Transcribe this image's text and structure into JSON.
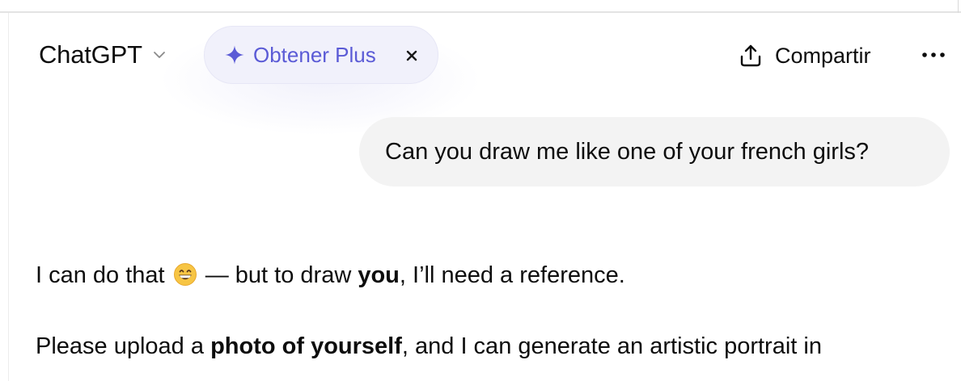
{
  "header": {
    "model_name": "ChatGPT",
    "model_chevron_icon": "chevron-down-icon",
    "upsell": {
      "label": "Obtener Plus",
      "icon": "sparkle-icon",
      "close_icon": "close-icon",
      "accent_color": "#5b5bd6",
      "background_color": "#f1f1fb"
    },
    "share": {
      "label": "Compartir",
      "icon": "share-icon"
    },
    "more_icon": "more-horizontal-icon"
  },
  "conversation": {
    "user_message": {
      "text": "Can you draw me like one of your french girls?",
      "bubble_color": "#f3f3f3"
    },
    "assistant_message": {
      "line1": {
        "before": "I can do that",
        "emoji": "grinning-face-emoji",
        "middle": " — but to draw ",
        "bold": "you",
        "after": ", I’ll need a reference."
      },
      "line2": {
        "before": "Please upload a ",
        "bold": "photo of yourself",
        "after": ", and I can generate an artistic portrait in"
      }
    }
  }
}
